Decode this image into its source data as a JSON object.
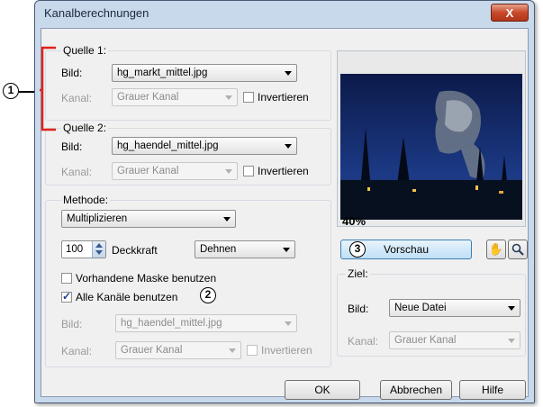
{
  "window": {
    "title": "Kanalberechnungen",
    "close_glyph": "X"
  },
  "quelle1": {
    "legend": "Quelle 1:",
    "bild_label": "Bild:",
    "bild_value": "hg_markt_mittel.jpg",
    "kanal_label": "Kanal:",
    "kanal_value": "Grauer Kanal",
    "invert_label": "Invertieren"
  },
  "quelle2": {
    "legend": "Quelle 2:",
    "bild_label": "Bild:",
    "bild_value": "hg_haendel_mittel.jpg",
    "kanal_label": "Kanal:",
    "kanal_value": "Grauer Kanal",
    "invert_label": "Invertieren"
  },
  "methode": {
    "legend": "Methode:",
    "value": "Multiplizieren",
    "opacity_value": "100",
    "opacity_label": "Deckkraft",
    "mode_value": "Dehnen",
    "mask_label": "Vorhandene Maske benutzen",
    "mask_checked": false,
    "all_channels_label": "Alle Kanäle benutzen",
    "all_channels_checked": true,
    "bild_label": "Bild:",
    "bild_value": "hg_haendel_mittel.jpg",
    "kanal_label": "Kanal:",
    "kanal_value": "Grauer Kanal",
    "invert_label": "Invertieren"
  },
  "preview": {
    "zoom": "40%",
    "button_label": "Vorschau",
    "hand_icon": "hand-icon",
    "zoom_icon": "magnifier-icon"
  },
  "ziel": {
    "legend": "Ziel:",
    "bild_label": "Bild:",
    "bild_value": "Neue Datei",
    "kanal_label": "Kanal:",
    "kanal_value": "Grauer Kanal"
  },
  "buttons": {
    "ok": "OK",
    "cancel": "Abbrechen",
    "help": "Hilfe"
  },
  "callouts": {
    "one": "1",
    "two": "2",
    "three": "3"
  },
  "colors": {
    "annotation_red": "#e0231b",
    "dialog_frame": "#c9d9ec",
    "client_bg": "#f0f0f0"
  }
}
